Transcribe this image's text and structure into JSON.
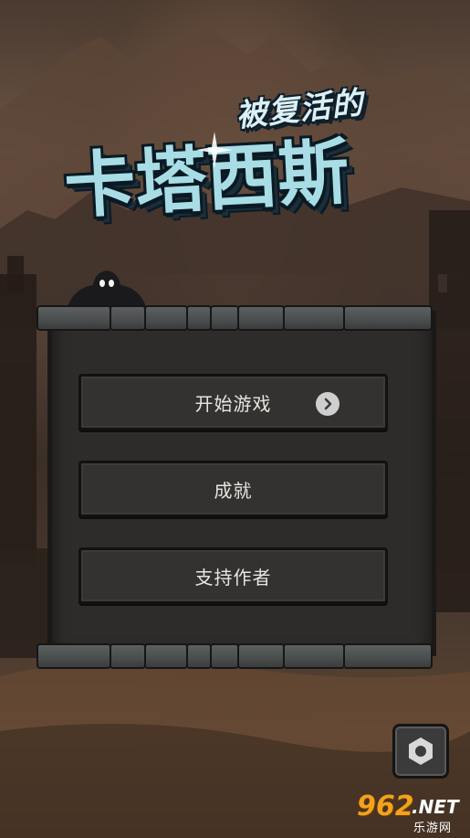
{
  "game": {
    "subtitle": "被复活的",
    "title": "卡塔西斯"
  },
  "menu": {
    "items": [
      {
        "label": "开始游戏",
        "has_arrow": true
      },
      {
        "label": "成就"
      },
      {
        "label": "支持作者"
      }
    ]
  },
  "settings": {
    "icon": "hexagon-gear-icon"
  },
  "watermark": {
    "number": "962",
    "suffix": ".NET",
    "chinese": "乐游网"
  },
  "colors": {
    "title_fill": "#a9dde6",
    "panel_stone": "#4a4d4d",
    "button_bg": "#343231",
    "button_text": "#e8e4de",
    "watermark_orange": "#f2a21c"
  }
}
